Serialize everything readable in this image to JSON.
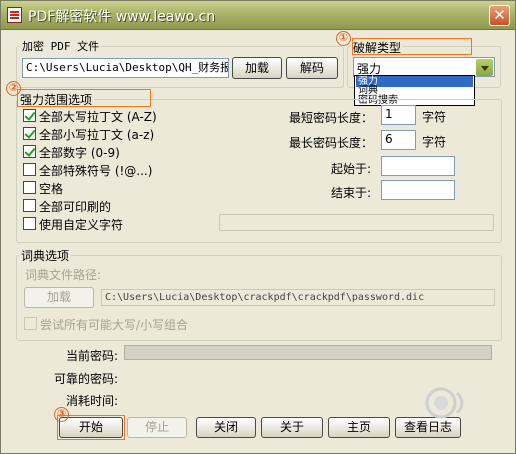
{
  "window": {
    "title": "PDF解密软件 www.leawo.cn"
  },
  "encrypted_file": {
    "legend": "加密 PDF 文件",
    "path": "C:\\Users\\Lucia\\Desktop\\QH_财务报表",
    "load_label": "加载",
    "decrypt_label": "解码"
  },
  "crack_type": {
    "legend": "破解类型",
    "selected": "强力",
    "options": [
      "强力",
      "词典",
      "密码搜索"
    ]
  },
  "brute": {
    "legend": "强力范围选项",
    "options": [
      {
        "label": "全部大写拉丁文 (A-Z)",
        "checked": true
      },
      {
        "label": "全部小写拉丁文 (a-z)",
        "checked": true
      },
      {
        "label": "全部数字 (0-9)",
        "checked": true
      },
      {
        "label": "全部特殊符号 (!@...)",
        "checked": false
      },
      {
        "label": "空格",
        "checked": false
      },
      {
        "label": "全部可印刷的",
        "checked": false
      },
      {
        "label": "使用自定义字符",
        "checked": false
      }
    ],
    "min_len_label": "最短密码长度：",
    "min_len_value": "1",
    "max_len_label": "最长密码长度：",
    "max_len_value": "6",
    "unit": "字符",
    "start_label": "起始于:",
    "start_value": "",
    "end_label": "结束于:",
    "end_value": ""
  },
  "dictionary": {
    "legend": "词典选项",
    "path_label": "词典文件路径:",
    "load_label": "加载",
    "path": "C:\\Users\\Lucia\\Desktop\\crackpdf\\crackpdf\\password.dic",
    "case_label": "尝试所有可能大写/小写组合"
  },
  "status": {
    "current_label": "当前密码:",
    "found_label": "可靠的密码:",
    "time_label": "消耗时间:"
  },
  "buttons": {
    "start": "开始",
    "stop": "停止",
    "close": "关闭",
    "about": "关于",
    "home": "主页",
    "log": "查看日志"
  },
  "callouts": {
    "one": "①",
    "two": "②",
    "three": "③"
  },
  "colors": {
    "callout": "#f0781e",
    "title_bar": "#a8b26a",
    "dialog_bg": "#ece9d8",
    "selection": "#316ac5"
  }
}
